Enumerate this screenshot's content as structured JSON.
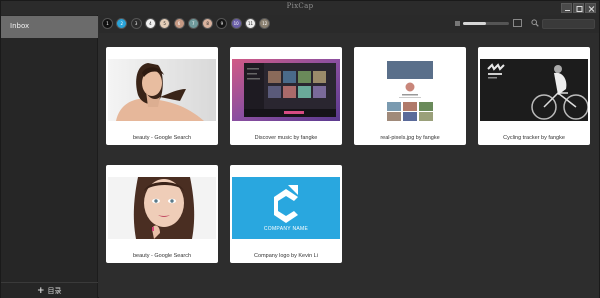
{
  "app": {
    "title": "PixCap"
  },
  "sidebar": {
    "items": [
      {
        "label": "Inbox"
      }
    ],
    "add_label": "目录"
  },
  "toolbar": {
    "tags": [
      {
        "number": "1",
        "color": "#111111"
      },
      {
        "number": "2",
        "color": "#29a3d8"
      },
      {
        "number": "3",
        "color": "#2b2b2b"
      },
      {
        "number": "4",
        "color": "#f2f2f2"
      },
      {
        "number": "5",
        "color": "#e3cdb8"
      },
      {
        "number": "6",
        "color": "#c79a84"
      },
      {
        "number": "7",
        "color": "#6f9a9c"
      },
      {
        "number": "8",
        "color": "#d9b29e"
      },
      {
        "number": "9",
        "color": "#151515"
      },
      {
        "number": "10",
        "color": "#6a5fa8"
      },
      {
        "number": "11",
        "color": "#eeeeee"
      },
      {
        "number": "12",
        "color": "#8a8070"
      }
    ],
    "zoom_level": 0.5,
    "search": {
      "placeholder": "",
      "value": ""
    }
  },
  "cards": [
    {
      "label": "beauty - Google Search",
      "thumbnail": "portrait-woman-shoulders"
    },
    {
      "label": "Discover music by fangke",
      "thumbnail": "music-app-ui"
    },
    {
      "label": "real-pixels.jpg by fangke",
      "thumbnail": "profile-grid-ui"
    },
    {
      "label": "Cycling tracker by fangke",
      "thumbnail": "cyclist-bw"
    },
    {
      "label": "beauty - Google Search",
      "thumbnail": "portrait-woman-face"
    },
    {
      "label": "Company logo by Kevin Li",
      "thumbnail": "company-logo",
      "logo_text": "COMPANY NAME"
    }
  ]
}
